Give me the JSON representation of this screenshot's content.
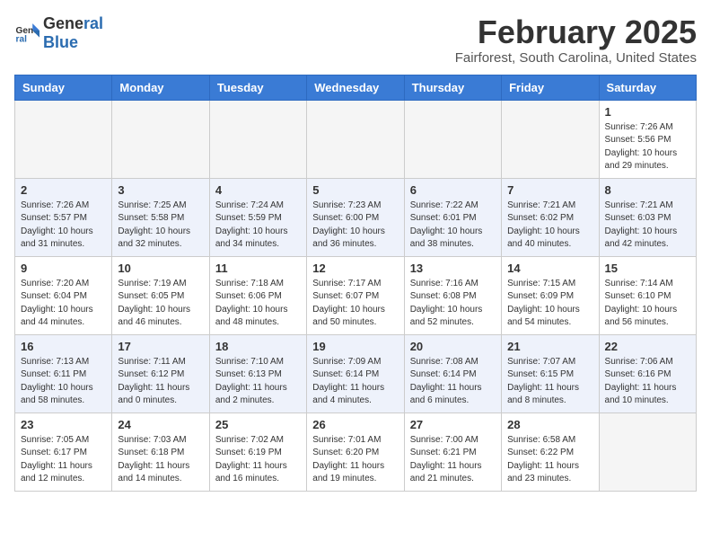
{
  "header": {
    "logo_general": "General",
    "logo_blue": "Blue",
    "month_title": "February 2025",
    "location": "Fairforest, South Carolina, United States"
  },
  "weekdays": [
    "Sunday",
    "Monday",
    "Tuesday",
    "Wednesday",
    "Thursday",
    "Friday",
    "Saturday"
  ],
  "weeks": [
    [
      {
        "day": "",
        "info": ""
      },
      {
        "day": "",
        "info": ""
      },
      {
        "day": "",
        "info": ""
      },
      {
        "day": "",
        "info": ""
      },
      {
        "day": "",
        "info": ""
      },
      {
        "day": "",
        "info": ""
      },
      {
        "day": "1",
        "info": "Sunrise: 7:26 AM\nSunset: 5:56 PM\nDaylight: 10 hours\nand 29 minutes."
      }
    ],
    [
      {
        "day": "2",
        "info": "Sunrise: 7:26 AM\nSunset: 5:57 PM\nDaylight: 10 hours\nand 31 minutes."
      },
      {
        "day": "3",
        "info": "Sunrise: 7:25 AM\nSunset: 5:58 PM\nDaylight: 10 hours\nand 32 minutes."
      },
      {
        "day": "4",
        "info": "Sunrise: 7:24 AM\nSunset: 5:59 PM\nDaylight: 10 hours\nand 34 minutes."
      },
      {
        "day": "5",
        "info": "Sunrise: 7:23 AM\nSunset: 6:00 PM\nDaylight: 10 hours\nand 36 minutes."
      },
      {
        "day": "6",
        "info": "Sunrise: 7:22 AM\nSunset: 6:01 PM\nDaylight: 10 hours\nand 38 minutes."
      },
      {
        "day": "7",
        "info": "Sunrise: 7:21 AM\nSunset: 6:02 PM\nDaylight: 10 hours\nand 40 minutes."
      },
      {
        "day": "8",
        "info": "Sunrise: 7:21 AM\nSunset: 6:03 PM\nDaylight: 10 hours\nand 42 minutes."
      }
    ],
    [
      {
        "day": "9",
        "info": "Sunrise: 7:20 AM\nSunset: 6:04 PM\nDaylight: 10 hours\nand 44 minutes."
      },
      {
        "day": "10",
        "info": "Sunrise: 7:19 AM\nSunset: 6:05 PM\nDaylight: 10 hours\nand 46 minutes."
      },
      {
        "day": "11",
        "info": "Sunrise: 7:18 AM\nSunset: 6:06 PM\nDaylight: 10 hours\nand 48 minutes."
      },
      {
        "day": "12",
        "info": "Sunrise: 7:17 AM\nSunset: 6:07 PM\nDaylight: 10 hours\nand 50 minutes."
      },
      {
        "day": "13",
        "info": "Sunrise: 7:16 AM\nSunset: 6:08 PM\nDaylight: 10 hours\nand 52 minutes."
      },
      {
        "day": "14",
        "info": "Sunrise: 7:15 AM\nSunset: 6:09 PM\nDaylight: 10 hours\nand 54 minutes."
      },
      {
        "day": "15",
        "info": "Sunrise: 7:14 AM\nSunset: 6:10 PM\nDaylight: 10 hours\nand 56 minutes."
      }
    ],
    [
      {
        "day": "16",
        "info": "Sunrise: 7:13 AM\nSunset: 6:11 PM\nDaylight: 10 hours\nand 58 minutes."
      },
      {
        "day": "17",
        "info": "Sunrise: 7:11 AM\nSunset: 6:12 PM\nDaylight: 11 hours\nand 0 minutes."
      },
      {
        "day": "18",
        "info": "Sunrise: 7:10 AM\nSunset: 6:13 PM\nDaylight: 11 hours\nand 2 minutes."
      },
      {
        "day": "19",
        "info": "Sunrise: 7:09 AM\nSunset: 6:14 PM\nDaylight: 11 hours\nand 4 minutes."
      },
      {
        "day": "20",
        "info": "Sunrise: 7:08 AM\nSunset: 6:14 PM\nDaylight: 11 hours\nand 6 minutes."
      },
      {
        "day": "21",
        "info": "Sunrise: 7:07 AM\nSunset: 6:15 PM\nDaylight: 11 hours\nand 8 minutes."
      },
      {
        "day": "22",
        "info": "Sunrise: 7:06 AM\nSunset: 6:16 PM\nDaylight: 11 hours\nand 10 minutes."
      }
    ],
    [
      {
        "day": "23",
        "info": "Sunrise: 7:05 AM\nSunset: 6:17 PM\nDaylight: 11 hours\nand 12 minutes."
      },
      {
        "day": "24",
        "info": "Sunrise: 7:03 AM\nSunset: 6:18 PM\nDaylight: 11 hours\nand 14 minutes."
      },
      {
        "day": "25",
        "info": "Sunrise: 7:02 AM\nSunset: 6:19 PM\nDaylight: 11 hours\nand 16 minutes."
      },
      {
        "day": "26",
        "info": "Sunrise: 7:01 AM\nSunset: 6:20 PM\nDaylight: 11 hours\nand 19 minutes."
      },
      {
        "day": "27",
        "info": "Sunrise: 7:00 AM\nSunset: 6:21 PM\nDaylight: 11 hours\nand 21 minutes."
      },
      {
        "day": "28",
        "info": "Sunrise: 6:58 AM\nSunset: 6:22 PM\nDaylight: 11 hours\nand 23 minutes."
      },
      {
        "day": "",
        "info": ""
      }
    ]
  ]
}
